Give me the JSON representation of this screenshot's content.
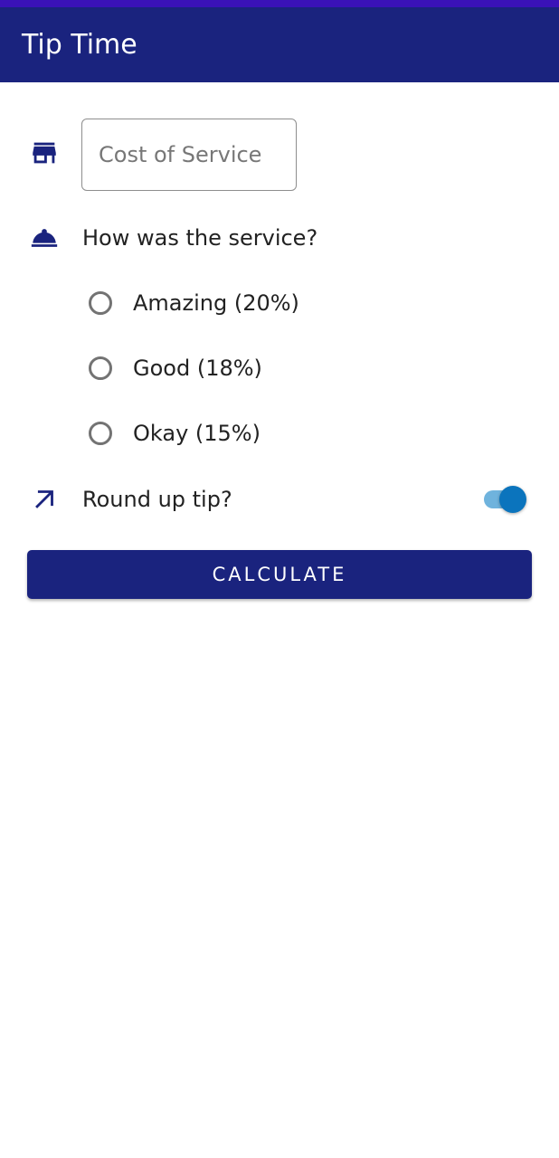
{
  "app_bar": {
    "title": "Tip Time"
  },
  "cost_input": {
    "placeholder": "Cost of Service",
    "value": ""
  },
  "service_question": "How was the service?",
  "tip_options": [
    {
      "label": "Amazing (20%)",
      "selected": false
    },
    {
      "label": "Good (18%)",
      "selected": false
    },
    {
      "label": "Okay (15%)",
      "selected": false
    }
  ],
  "round_up": {
    "label": "Round up tip?",
    "enabled": true
  },
  "calculate_button": {
    "label": "CALCULATE"
  },
  "icons": {
    "cost": "store-icon",
    "service": "room-service-icon",
    "round_up": "trending-up-arrow-icon"
  },
  "colors": {
    "primary": "#1a237e",
    "status_bar": "#3a12b8",
    "switch_thumb": "#0b74bd",
    "switch_track": "#6fb3dd"
  }
}
